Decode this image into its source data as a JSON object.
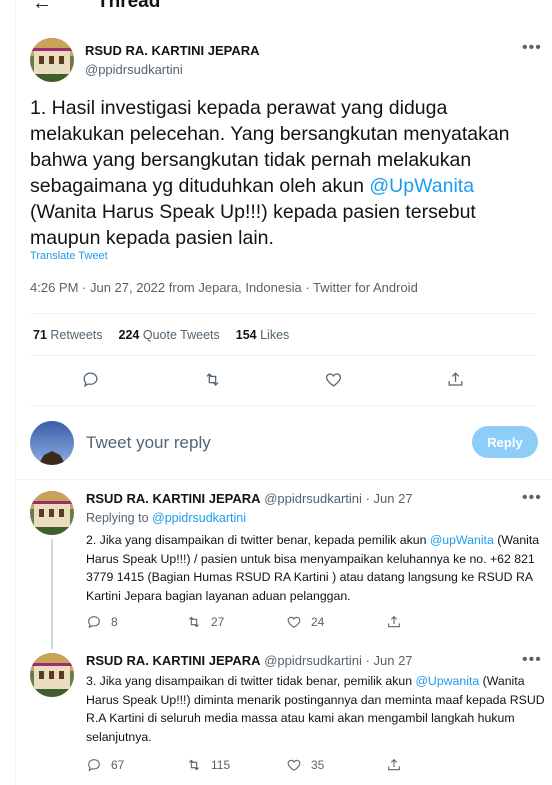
{
  "header": {
    "back_icon": "arrow-left-icon",
    "title": "Thread"
  },
  "main_tweet": {
    "author_name": "RSUD RA. KARTINI JEPARA",
    "author_handle": "@ppidrsudkartini",
    "text_part1": "1. Hasil investigasi kepada perawat yang diduga melakukan pelecehan.  Yang bersangkutan menyatakan bahwa yang bersangkutan tidak pernah melakukan sebagaimana yg dituduhkan oleh akun ",
    "mention": "@UpWanita",
    "text_part2": " (Wanita Harus Speak Up!!!) kepada pasien tersebut maupun kepada pasien lain.",
    "translate_label": "Translate Tweet",
    "meta": "4:26 PM · Jun 27, 2022 from Jepara, Indonesia · Twitter for Android",
    "stats": {
      "retweets_count": "71",
      "retweets_label": "Retweets",
      "quotes_count": "224",
      "quotes_label": "Quote Tweets",
      "likes_count": "154",
      "likes_label": "Likes"
    }
  },
  "reply_box": {
    "placeholder": "Tweet your reply",
    "button_label": "Reply"
  },
  "replies": [
    {
      "author_name": "RSUD RA. KARTINI JEPARA",
      "author_handle": "@ppidrsudkartini",
      "date": "· Jun 27",
      "replying_prefix": "Replying to ",
      "replying_to": "@ppidrsudkartini",
      "text_part1": "2. Jika yang disampaikan di twitter benar, kepada pemilik akun ",
      "mention": "@upWanita",
      "text_part2": " (Wanita Harus Speak Up!!!) / pasien untuk bisa menyampaikan keluhannya ke no. +62 821 3779 1415 (Bagian Humas RSUD RA Kartini ) atau datang langsung ke RSUD RA Kartini Jepara bagian layanan aduan pelanggan.",
      "replies_count": "8",
      "retweets_count": "27",
      "likes_count": "24"
    },
    {
      "author_name": "RSUD RA. KARTINI JEPARA",
      "author_handle": "@ppidrsudkartini",
      "date": "· Jun 27",
      "text_part1": "3. Jika yang disampaikan di twitter tidak benar, pemilik akun ",
      "mention": "@Upwanita",
      "text_part2": " (Wanita Harus Speak Up!!!) diminta menarik postingannya dan meminta maaf kepada RSUD R.A Kartini di seluruh media massa atau kami akan mengambil langkah hukum selanjutnya.",
      "replies_count": "67",
      "retweets_count": "115",
      "likes_count": "35"
    }
  ],
  "colors": {
    "accent": "#1d9bf0",
    "muted": "#536471",
    "reply_button_disabled": "#8ecdf8"
  }
}
